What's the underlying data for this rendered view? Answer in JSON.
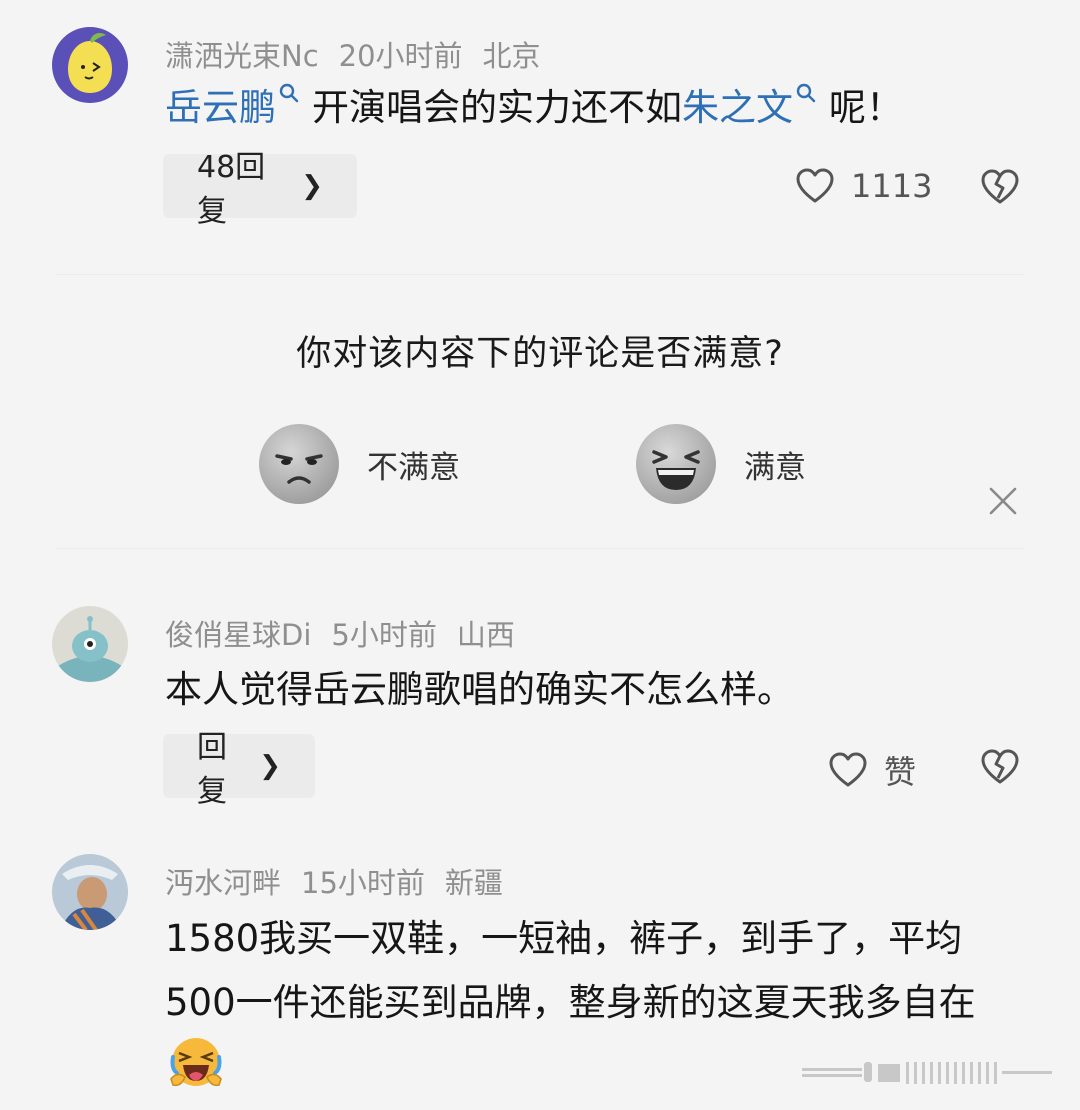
{
  "comments": [
    {
      "username": "潇洒光束Nc",
      "time": "20小时前",
      "location": "北京",
      "text_parts": {
        "link1": "岳云鹏",
        "middle": "开演唱会的实力还不如",
        "link2": "朱之文",
        "end": "呢！"
      },
      "reply_label": "48回复",
      "like_count": "1113"
    },
    {
      "username": "俊俏星球Di",
      "time": "5小时前",
      "location": "山西",
      "text": "本人觉得岳云鹏歌唱的确实不怎么样。",
      "reply_label": "回复",
      "like_label": "赞"
    },
    {
      "username": "沔水河畔",
      "time": "15小时前",
      "location": "新疆",
      "text": "1580我买一双鞋，一短袖，裤子，到手了，平均500一件还能买到品牌，整身新的这夏天我多自在"
    }
  ],
  "survey": {
    "question": "你对该内容下的评论是否满意?",
    "option_bad": "不满意",
    "option_good": "满意"
  },
  "colors": {
    "link": "#2f6fb6",
    "meta": "#8f8f8f",
    "background": "#f4f4f4"
  },
  "icons": [
    "search-icon",
    "chevron-right-icon",
    "heart-icon",
    "broken-heart-icon",
    "close-icon",
    "unhappy-face-icon",
    "laughing-face-icon",
    "laughing-emoji"
  ]
}
